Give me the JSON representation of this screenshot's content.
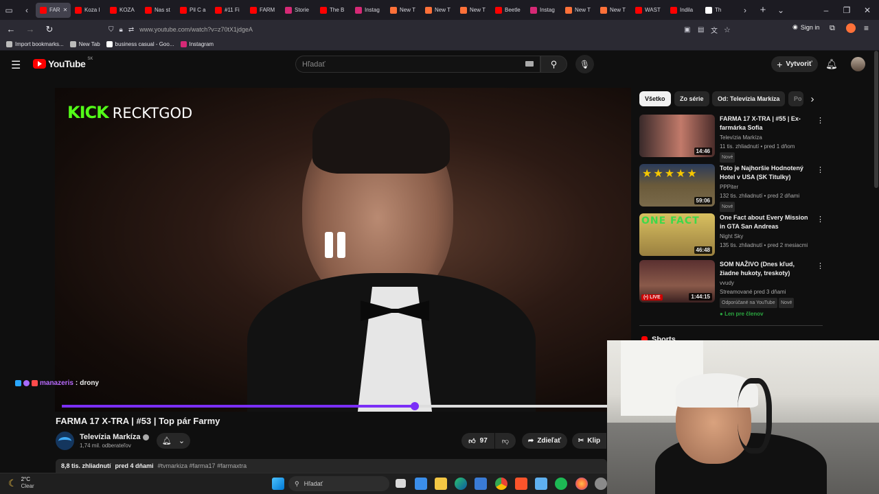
{
  "browser": {
    "tabs": [
      {
        "label": "FAR",
        "color": "#ff0000",
        "active": true
      },
      {
        "label": "Koza I",
        "color": "#ff0000"
      },
      {
        "label": "KOZA",
        "color": "#ff0000"
      },
      {
        "label": "Nas st",
        "color": "#ff0000"
      },
      {
        "label": "Pil C a",
        "color": "#ff0000"
      },
      {
        "label": "#11 Fi",
        "color": "#ff0000"
      },
      {
        "label": "FARM",
        "color": "#ff0000"
      },
      {
        "label": "Storie",
        "color": "#d62976"
      },
      {
        "label": "The B",
        "color": "#ff0000"
      },
      {
        "label": "Instag",
        "color": "#d62976"
      },
      {
        "label": "New T",
        "color": "#ff7139"
      },
      {
        "label": "New T",
        "color": "#ff7139"
      },
      {
        "label": "New T",
        "color": "#ff7139"
      },
      {
        "label": "Beetle",
        "color": "#ff0000"
      },
      {
        "label": "Instag",
        "color": "#d62976"
      },
      {
        "label": "New T",
        "color": "#ff7139"
      },
      {
        "label": "New T",
        "color": "#ff7139"
      },
      {
        "label": "WAST",
        "color": "#ff0000"
      },
      {
        "label": "Indila",
        "color": "#ff0000"
      },
      {
        "label": "Th",
        "color": "#ffffff"
      }
    ],
    "url": "www.youtube.com/watch?v=z70tX1jdgeA",
    "sign_in": "Sign in",
    "bookmarks": [
      {
        "label": "Import bookmarks...",
        "icon": "import-icon"
      },
      {
        "label": "New Tab",
        "icon": "globe-icon"
      },
      {
        "label": "business casual - Goo...",
        "icon": "google-icon"
      },
      {
        "label": "Instagram",
        "icon": "instagram-icon"
      }
    ]
  },
  "youtube": {
    "logo_text": "YouTube",
    "region": "SK",
    "search_placeholder": "Hľadať",
    "create_label": "Vytvoriť"
  },
  "video": {
    "overlay_brand": "KICK",
    "overlay_name": "RECKTGOD",
    "chat_user": "manazeris",
    "chat_sep": ":",
    "chat_msg": "drony",
    "progress_played": 0.62,
    "progress_buffered": 0.53,
    "title": "FARMA 17 X-TRA | #53 | Top pár Farmy",
    "channel": "Televízia Markíza",
    "subscribers": "1,74 mil. odberateľov",
    "likes": "97",
    "share_label": "Zdieľať",
    "clip_label": "Klip",
    "views": "8,8 tis. zhliadnutí",
    "date": "pred 4 dňami",
    "tags": "#tvmarkiza #farma17 #farmaxtra"
  },
  "chips": [
    "Všetko",
    "Zo série",
    "Od: Televízia Markíza",
    "Po"
  ],
  "recommendations": [
    {
      "title": "FARMA 17 X-TRA | #55 | Ex-farmárka Sofia",
      "channel": "Televízia Markíza",
      "meta": "11 tis. zhliadnutí • pred 1 dňom",
      "badge": "Nové",
      "duration": "14:46",
      "thumb": "#8a3a3a"
    },
    {
      "title": "Toto je Najhoršie Hodnotený Hotel v USA (SK Titulky)",
      "channel": "PPPiter",
      "meta": "132 tis. zhliadnutí • pred 2 dňami",
      "badge": "Nové",
      "duration": "59:06",
      "thumb": "#7d6a3a"
    },
    {
      "title": "One Fact about Every Mission in GTA San Andreas",
      "channel": "Night Sky",
      "meta": "135 tis. zhliadnutí • pred 2 mesiacmi",
      "badge": "",
      "duration": "46:48",
      "thumb": "#b9a04a"
    },
    {
      "title": "SOM NAŽIVO (Dnes kľud, žiadne hukoty, treskoty)",
      "channel": "vvudy",
      "meta": "Streamované pred 3 dňami",
      "badge": "Odporúčané na YouTube",
      "badge2": "Nové",
      "members": "Len pre členov",
      "duration": "1:44:15",
      "live": "LIVE",
      "thumb": "#6a4a4a"
    }
  ],
  "shorts_label": "Shorts",
  "taskbar": {
    "temp": "2°C",
    "weather": "Clear",
    "search": "Hľadať"
  }
}
